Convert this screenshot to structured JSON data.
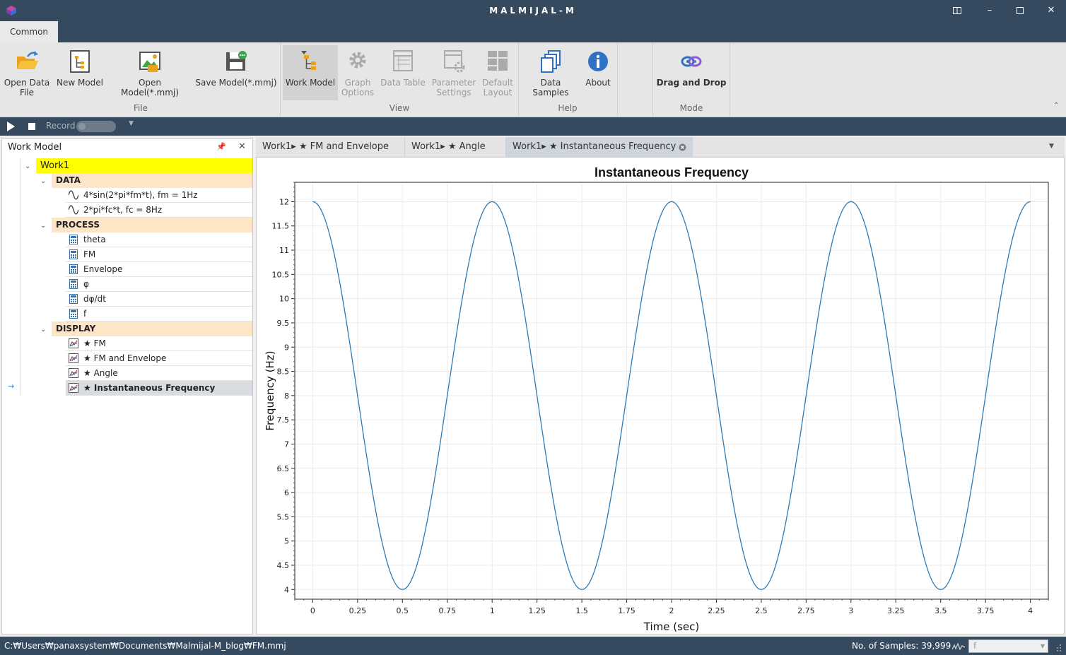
{
  "window": {
    "title": "MALMIJAL-M"
  },
  "ribbon": {
    "tab": "Common",
    "buttons": {
      "open_data_file": "Open Data\nFile",
      "new_model": "New Model",
      "open_model": "Open Model(*.mmj)",
      "save_model": "Save Model(*.mmj)",
      "work_model": "Work Model",
      "graph_options": "Graph\nOptions",
      "data_table": "Data Table",
      "parameter_settings": "Parameter\nSettings",
      "default_layout": "Default\nLayout",
      "data_samples": "Data Samples",
      "about": "About",
      "drag_and_drop": "Drag and Drop"
    },
    "groups": {
      "file": "File",
      "view": "View",
      "help": "Help",
      "mode": "Mode"
    }
  },
  "playbar": {
    "record_label": "Record"
  },
  "work_model_panel": {
    "title": "Work Model",
    "root": "Work1",
    "sections": {
      "data": "DATA",
      "process": "PROCESS",
      "display": "DISPLAY"
    },
    "data_items": [
      "4*sin(2*pi*fm*t), fm = 1Hz",
      "2*pi*fc*t, fc = 8Hz"
    ],
    "process_items": [
      "theta",
      "FM",
      "Envelope",
      "φ",
      "dφ/dt",
      "f"
    ],
    "display_items": [
      "★ FM",
      "★ FM and Envelope",
      "★ Angle",
      "★ Instantaneous Frequency"
    ]
  },
  "doc_tabs": [
    "Work1▸ ★ FM and Envelope",
    "Work1▸ ★ Angle",
    "Work1▸ ★ Instantaneous Frequency"
  ],
  "chart_data": {
    "type": "line",
    "title": "Instantaneous Frequency",
    "xlabel": "Time (sec)",
    "ylabel": "Frequency (Hz)",
    "xlim": [
      -0.1,
      4.1
    ],
    "ylim": [
      3.8,
      12.4
    ],
    "xticks": [
      0,
      0.25,
      0.5,
      0.75,
      1,
      1.25,
      1.5,
      1.75,
      2,
      2.25,
      2.5,
      2.75,
      3,
      3.25,
      3.5,
      3.75,
      4
    ],
    "xtick_labels": [
      "0",
      "0.25",
      "0.5",
      "0.75",
      "1",
      "1.25",
      "1.5",
      "1.75",
      "2",
      "2.25",
      "2.5",
      "2.75",
      "3",
      "3.25",
      "3.5",
      "3.75",
      "4"
    ],
    "yticks": [
      4,
      4.5,
      5,
      5.5,
      6,
      6.5,
      7,
      7.5,
      8,
      8.5,
      9,
      9.5,
      10,
      10.5,
      11,
      11.5,
      12
    ],
    "ytick_labels": [
      "4",
      "4.5",
      "5",
      "5.5",
      "6",
      "6.5",
      "7",
      "7.5",
      "8",
      "8.5",
      "9",
      "9.5",
      "10",
      "10.5",
      "11",
      "11.5",
      "12"
    ],
    "grid": true,
    "series": [
      {
        "color": "#2e7bb6",
        "x": [
          0,
          0.5,
          1,
          1.5,
          2,
          2.5,
          3,
          3.5,
          4
        ],
        "y": [
          12,
          4,
          12,
          4,
          12,
          4,
          12,
          4,
          12
        ],
        "shape": "cosine",
        "formula": "8 + 4*cos(2*pi*1*t)"
      }
    ]
  },
  "status": {
    "path": "C:₩Users₩panaxsystem₩Documents₩Malmijal-M_blog₩FM.mmj",
    "samples": "No. of Samples: 39,999",
    "channel": "f"
  },
  "colors": {
    "chrome": "#354a5f",
    "root_highlight": "#ffff00",
    "section_bg": "#fde5c8",
    "line": "#2e7bb6"
  }
}
